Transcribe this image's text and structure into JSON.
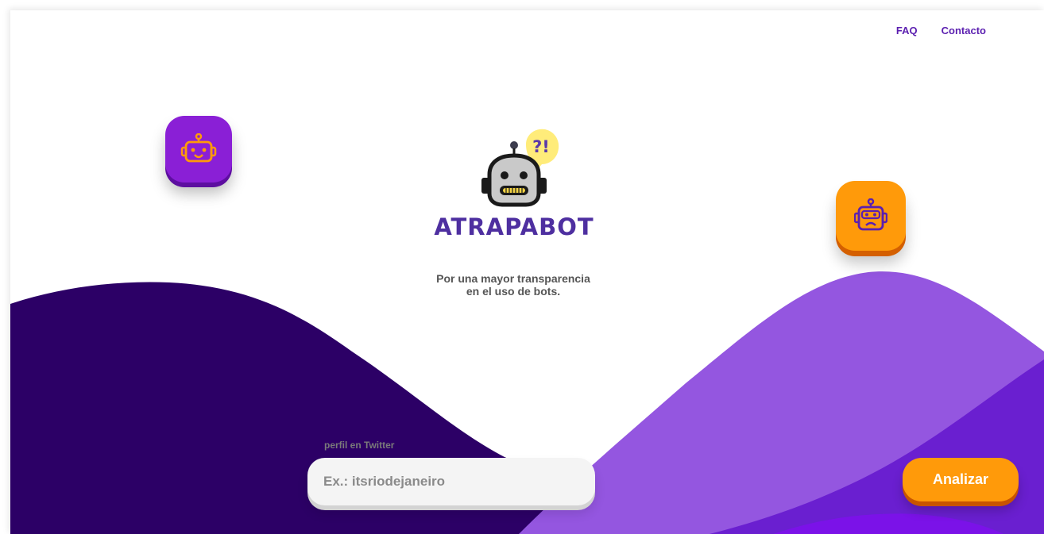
{
  "nav": {
    "faq": "FAQ",
    "contact": "Contacto"
  },
  "brand": {
    "name": "ATRAPABOT"
  },
  "logo": {
    "bubble_text": "?!"
  },
  "tagline": "Por una mayor transparencia en el uso de bots.",
  "search": {
    "label": "perfil en Twitter",
    "placeholder": "Ex.: itsriodejaneiro",
    "value": ""
  },
  "actions": {
    "analyze": "Analizar"
  },
  "icons": {
    "left_tile": "robot-face-smile-icon",
    "right_tile": "robot-face-frown-icon"
  },
  "colors": {
    "accent_purple": "#8a1fd6",
    "accent_orange": "#ff9a0a",
    "deep_purple": "#2c0066",
    "wave_purple": "#9456e0",
    "nav_text": "#5b1fb0"
  }
}
